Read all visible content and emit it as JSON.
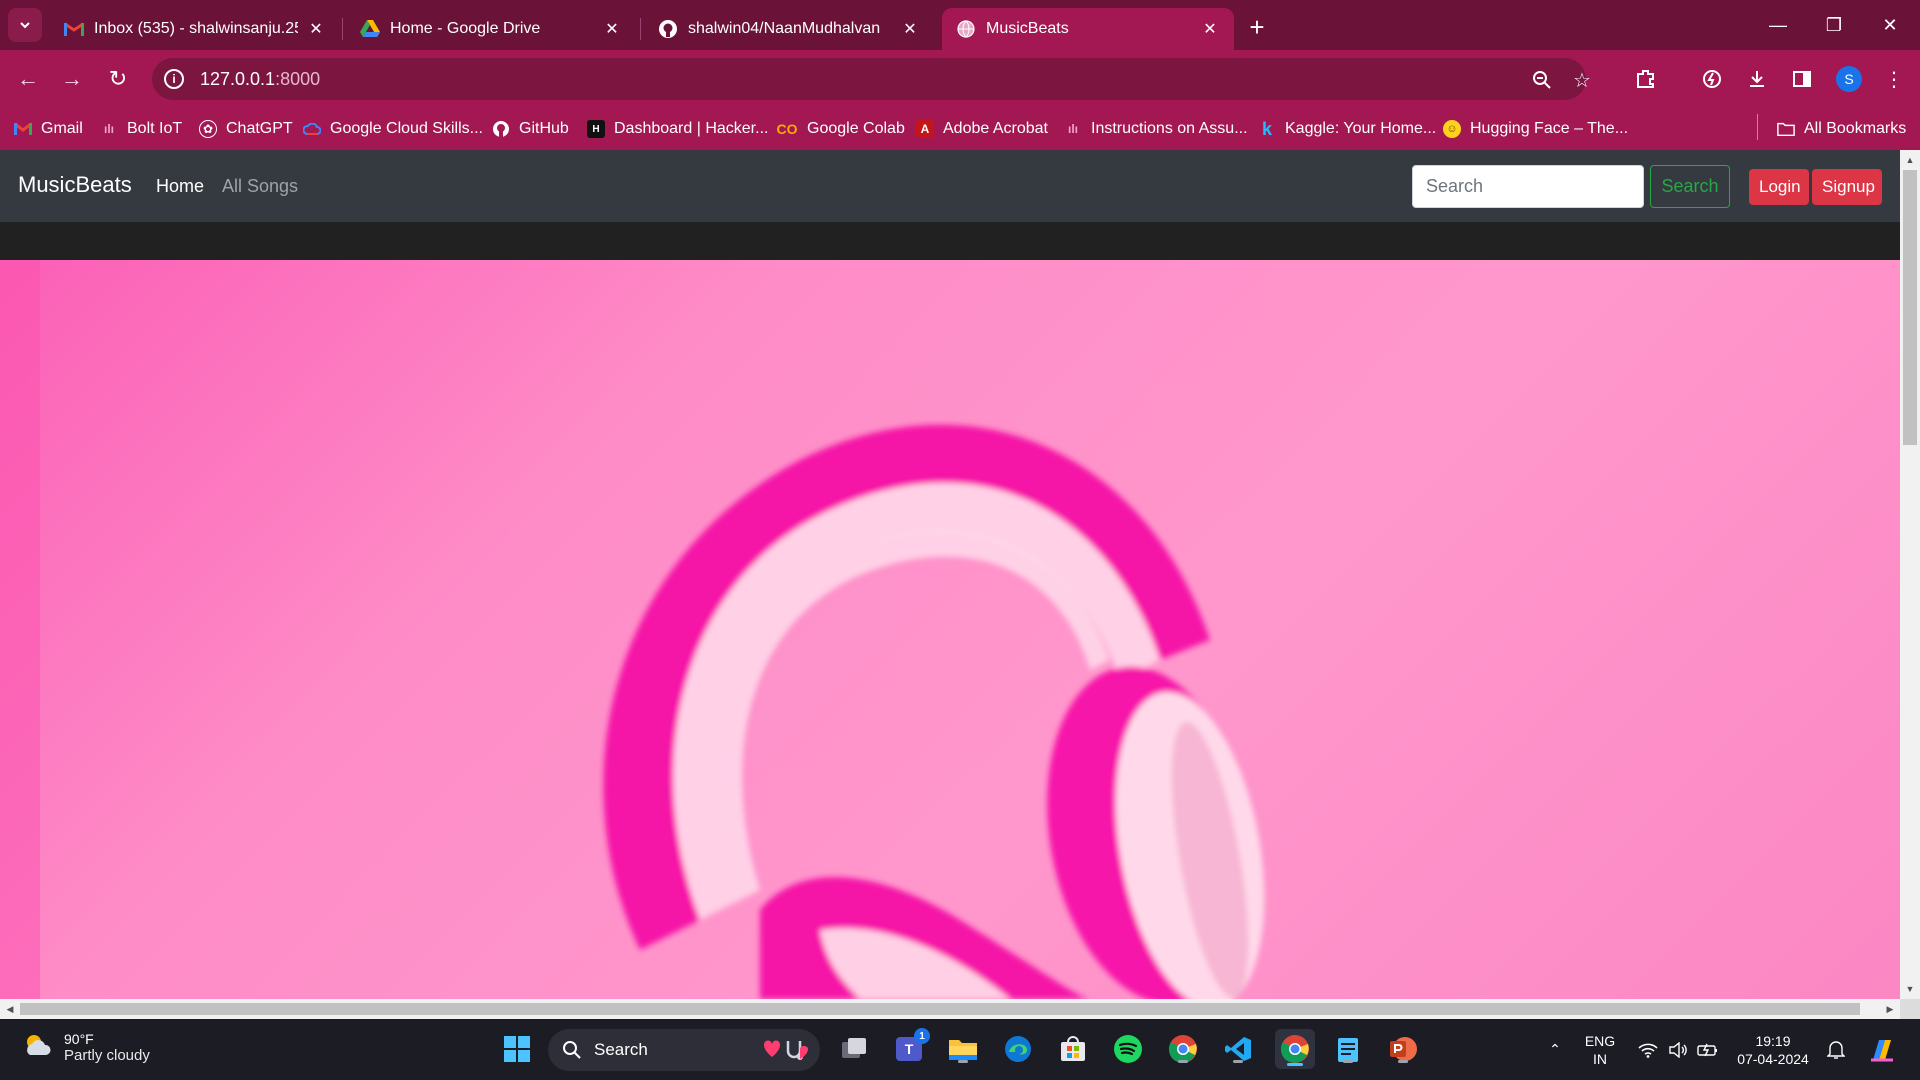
{
  "browser": {
    "tabs": [
      {
        "title": "Inbox (535) - shalwinsanju.25cs",
        "icon": "gmail-icon",
        "active": false
      },
      {
        "title": "Home - Google Drive",
        "icon": "google-drive-icon",
        "active": false
      },
      {
        "title": "shalwin04/NaanMudhalvan",
        "icon": "github-icon",
        "active": false
      },
      {
        "title": "MusicBeats",
        "icon": "globe-icon",
        "active": true
      }
    ],
    "url_host": "127.0.0.1",
    "url_port": ":8000",
    "profile_initial": "S",
    "bookmarks": [
      {
        "label": "Gmail",
        "icon": "gmail-icon"
      },
      {
        "label": "Bolt IoT",
        "icon": "bolt-iot-icon"
      },
      {
        "label": "ChatGPT",
        "icon": "chatgpt-icon"
      },
      {
        "label": "Google Cloud Skills...",
        "icon": "google-cloud-icon"
      },
      {
        "label": "GitHub",
        "icon": "github-icon"
      },
      {
        "label": "Dashboard | Hacker...",
        "icon": "hackerrank-icon"
      },
      {
        "label": "Google Colab",
        "icon": "colab-icon"
      },
      {
        "label": "Adobe Acrobat",
        "icon": "acrobat-icon"
      },
      {
        "label": "Instructions on Assu...",
        "icon": "waveform-icon"
      },
      {
        "label": "Kaggle: Your Home...",
        "icon": "kaggle-icon"
      },
      {
        "label": "Hugging Face – The...",
        "icon": "hugging-face-icon"
      }
    ],
    "all_bookmarks": "All Bookmarks"
  },
  "app": {
    "brand": "MusicBeats",
    "nav": {
      "home": "Home",
      "all_songs": "All Songs"
    },
    "search_placeholder": "Search",
    "search_button": "Search",
    "login": "Login",
    "signup": "Signup"
  },
  "taskbar": {
    "weather_temp": "90°F",
    "weather_desc": "Partly cloudy",
    "search_label": "Search",
    "lang_top": "ENG",
    "lang_bottom": "IN",
    "time": "19:19",
    "date": "07-04-2024",
    "teams_badge": "1"
  },
  "colors": {
    "browser_frame": "#a31852",
    "tab_strip": "#6b1239",
    "app_nav": "#343a40",
    "success": "#28a745",
    "danger": "#dc3545",
    "hero_pink": "#ff97cc",
    "headphone_magenta": "#f515a8"
  }
}
